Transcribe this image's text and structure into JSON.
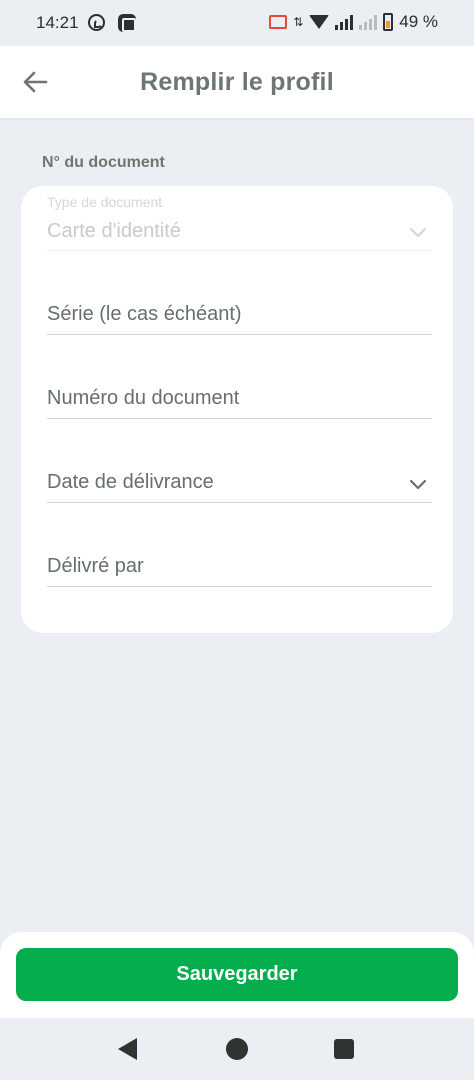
{
  "status_bar": {
    "time": "14:21",
    "battery": "49 %",
    "icons": [
      "whatsapp-icon",
      "app-notification-icon",
      "cast-icon",
      "data-arrows-icon",
      "wifi-icon",
      "signal-icon",
      "signal-icon",
      "battery-icon"
    ]
  },
  "app_bar": {
    "title": "Remplir le profil",
    "back_icon": "arrow-left-icon"
  },
  "section": {
    "label": "N° du document"
  },
  "form": {
    "document_type": {
      "label": "Type de document",
      "value": "Carte d'identité"
    },
    "series": {
      "placeholder": "Série (le cas échéant)"
    },
    "document_number": {
      "placeholder": "Numéro du document"
    },
    "issue_date": {
      "placeholder": "Date de délivrance"
    },
    "issued_by": {
      "placeholder": "Délivré par"
    }
  },
  "actions": {
    "save_label": "Sauvegarder"
  },
  "colors": {
    "background": "#ebeef3",
    "surface": "#ffffff",
    "primary": "#05ad4d",
    "text": "#66706a"
  }
}
